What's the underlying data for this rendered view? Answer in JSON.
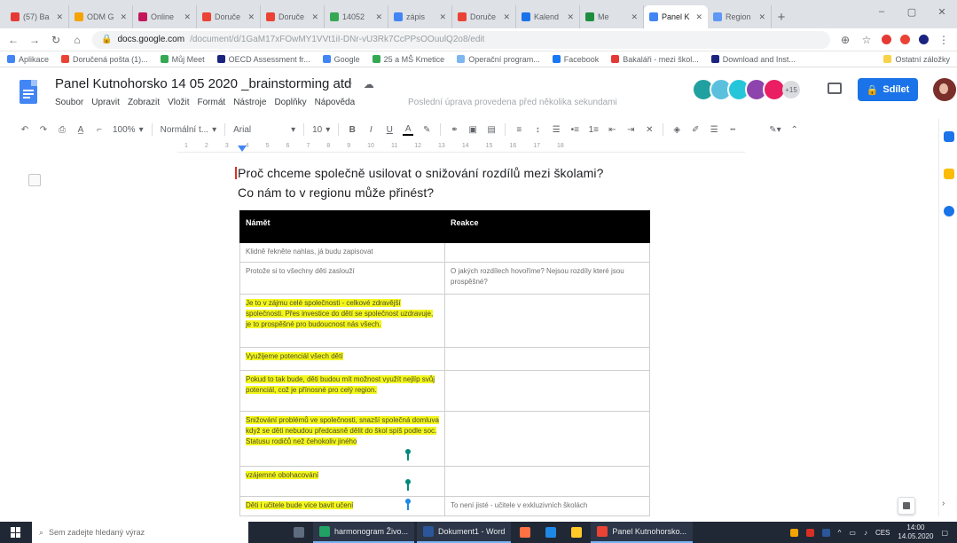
{
  "browser": {
    "tabs": [
      {
        "label": "(57) Ba",
        "color": "#e53935",
        "active": false
      },
      {
        "label": "ODM G",
        "color": "#f4a400",
        "active": false
      },
      {
        "label": "Online",
        "color": "#c2185b",
        "active": false
      },
      {
        "label": "Doruče",
        "color": "#ea4335",
        "active": false
      },
      {
        "label": "Doruče",
        "color": "#ea4335",
        "active": false
      },
      {
        "label": "14052",
        "color": "#34a853",
        "active": false
      },
      {
        "label": "zápis",
        "color": "#4285f4",
        "active": false
      },
      {
        "label": "Doruče",
        "color": "#ea4335",
        "active": false
      },
      {
        "label": "Kalend",
        "color": "#1a73e8",
        "active": false
      },
      {
        "label": "Me",
        "color": "#1e8e3e",
        "active": false
      },
      {
        "label": "Panel K",
        "color": "#4285f4",
        "active": true
      },
      {
        "label": "Region",
        "color": "#5e97f6",
        "active": false
      }
    ],
    "new_tab": "+",
    "window_controls": [
      "–",
      "▢",
      "✕"
    ],
    "url_host": "docs.google.com",
    "url_path": "/document/d/1GaM17xFOwMY1VVt1iI-DNr-vU3Rk7CcPPsOOuulQ2o8/edit",
    "bookmarks": [
      {
        "label": "Aplikace",
        "color": "#4285f4"
      },
      {
        "label": "Doručená pošta (1)...",
        "color": "#ea4335"
      },
      {
        "label": "Můj Meet",
        "color": "#34a853"
      },
      {
        "label": "OECD Assessment fr...",
        "color": "#1a237e"
      },
      {
        "label": "Google",
        "color": "#4285f4"
      },
      {
        "label": "25 a MŠ Kmetice",
        "color": "#34a853"
      },
      {
        "label": "Operační program...",
        "color": "#7cb7f0"
      },
      {
        "label": "Facebook",
        "color": "#1877f2"
      },
      {
        "label": "Bakaláři - mezi škol...",
        "color": "#e53935"
      },
      {
        "label": "Download and Inst...",
        "color": "#1a237e"
      }
    ],
    "other_bookmarks": "Ostatní záložky"
  },
  "docs": {
    "title": "Panel Kutnohorsko 14 05 2020 _brainstorming atd",
    "star_icon": "☆",
    "cloud_icon": "☁",
    "menu": [
      "Soubor",
      "Upravit",
      "Zobrazit",
      "Vložit",
      "Formát",
      "Nástroje",
      "Doplňky",
      "Nápověda"
    ],
    "last_edit": "Poslední úprava provedena před několika sekundami",
    "collaborators": [
      {
        "letter": "",
        "color": "#21a0a0"
      },
      {
        "letter": "",
        "color": "#5bc0de"
      },
      {
        "letter": "",
        "color": "#26c6da"
      },
      {
        "letter": "",
        "color": "#8e44ad"
      },
      {
        "letter": "",
        "color": "#e91e63"
      }
    ],
    "more_collaborators": "+15",
    "share_label": "Sdílet",
    "toolbar": {
      "zoom": "100%",
      "style": "Normální t...",
      "font": "Arial",
      "font_size": "10"
    }
  },
  "document": {
    "heading_line1": "Proč chceme společně usilovat o snižování rozdílů mezi školami?",
    "heading_line2": "Co nám to v regionu může přinést?",
    "table_headers": [
      "Námět",
      "Reakce"
    ],
    "rows": [
      {
        "topic": "Klidně řekněte nahlas, já budu zapisovat",
        "reaction": "",
        "highlight": false,
        "height": 22
      },
      {
        "topic": "Protože si to všechny děti zaslouží",
        "reaction": "O jakých rozdílech hovoříme? Nejsou rozdíly které jsou prospěšné?",
        "highlight": false,
        "height": 36
      },
      {
        "topic": "Je to v zájmu celé společnosti - celkové zdravější společnosti. Přes investice do dětí se společnost uzdravuje, je to prospěšné pro budoucnost nás všech.",
        "reaction": "",
        "highlight": true,
        "height": 60
      },
      {
        "topic": "Využijeme potenciál všech dětí",
        "reaction": "",
        "highlight": true,
        "height": 26
      },
      {
        "topic": "Pokud to tak bude, děti budou mít možnost využít nejlíp svůj potenciál, což je přínosné pro celý region.",
        "reaction": "",
        "highlight": true,
        "height": 46
      },
      {
        "topic": "Snižování problémů ve společnosti, snazší společná domluva když se děti nebudou předcasně dělit do škol spíš podle soc. Statusu rodičů než čehokoliv jiného",
        "reaction": "",
        "highlight": true,
        "height": 62
      },
      {
        "topic": "vzájemné obohacování",
        "reaction": "",
        "highlight": true,
        "height": 34
      },
      {
        "topic": "Děti i učitele bude více bavit učení",
        "reaction": "To není jisté - učitele v exkluzivních školách",
        "highlight": true,
        "height": 22
      }
    ]
  },
  "taskbar": {
    "search_placeholder": "Sem zadejte hledaný výraz",
    "apps": [
      {
        "label": "",
        "color": "#5f6c80",
        "open": false
      },
      {
        "label": "harmonogram Živo...",
        "color": "#21a366",
        "open": true
      },
      {
        "label": "Dokument1 - Word",
        "color": "#2b579a",
        "open": true
      },
      {
        "label": "",
        "color": "#ff7043",
        "open": false
      },
      {
        "label": "",
        "color": "#1e88e5",
        "open": false
      },
      {
        "label": "",
        "color": "#ffca28",
        "open": false
      },
      {
        "label": "Panel Kutnohorsko...",
        "color": "#ea4335",
        "open": true
      }
    ],
    "lang": "CES",
    "time": "14:00",
    "date": "14.05.2020"
  },
  "colors": {
    "accent": "#1a73e8",
    "highlight": "#f3f61c",
    "table_header_bg": "#000000"
  }
}
